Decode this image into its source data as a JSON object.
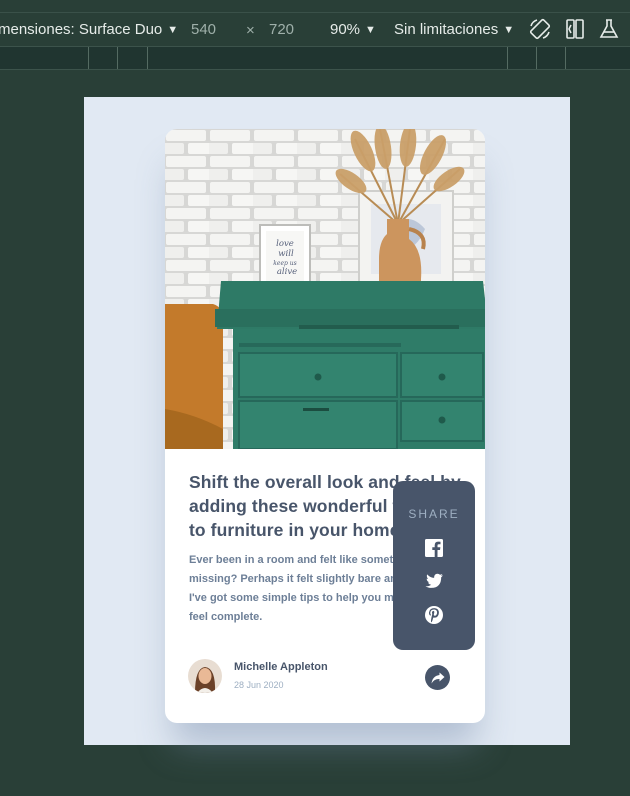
{
  "devtools": {
    "device_label": "mensiones: Surface Duo",
    "width_value": "540",
    "times": "×",
    "height_value": "720",
    "zoom": "90%",
    "throttle": "Sin limitaciones",
    "icons": [
      "rotate-icon",
      "dual-screen-icon",
      "experiment-flask-icon"
    ]
  },
  "card": {
    "title_lines": [
      "Shift the overall look and feel by",
      "adding these wonderful touches",
      "to furniture in your home"
    ],
    "description_lines": [
      "Ever been in a room and felt like something was",
      "missing? Perhaps it felt slightly bare and uninviting.",
      "I've got some simple tips to help you make any room",
      "feel complete."
    ],
    "frame_text": [
      "love",
      "will",
      "keep us",
      "alive"
    ],
    "author": {
      "name": "Michelle Appleton",
      "date": "28 Jun 2020"
    },
    "share": {
      "label": "SHARE",
      "networks": [
        "facebook-icon",
        "twitter-icon",
        "pinterest-icon"
      ]
    }
  },
  "colors": {
    "app_bg": "#293f37",
    "viewport_bg": "#e1e9f3",
    "card_bg": "#ffffff",
    "dark_grayish_blue": "#48556a",
    "grayish_blue": "#6d7f97",
    "light_grayish_blue": "#9eafc2",
    "dresser_green": "#2f7c68"
  }
}
